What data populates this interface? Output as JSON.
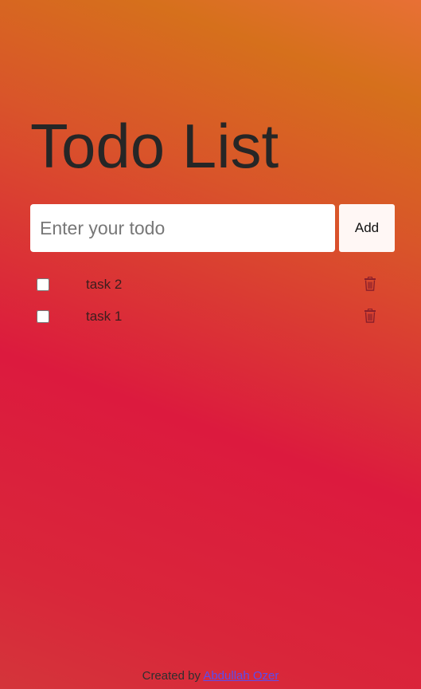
{
  "header": {
    "title": "Todo List"
  },
  "form": {
    "placeholder": "Enter your todo",
    "value": "",
    "add_label": "Add"
  },
  "todos": [
    {
      "text": "task 2",
      "checked": false,
      "delete_icon": "trash-icon"
    },
    {
      "text": "task 1",
      "checked": false,
      "delete_icon": "trash-icon"
    }
  ],
  "footer": {
    "prefix": "Created by",
    "author": "Abdullah Ozer"
  },
  "colors": {
    "background_top": "#d6701c",
    "background_bottom": "#dc1a3e",
    "trash_icon": "#8a1f2b",
    "link": "#5a4df0"
  }
}
